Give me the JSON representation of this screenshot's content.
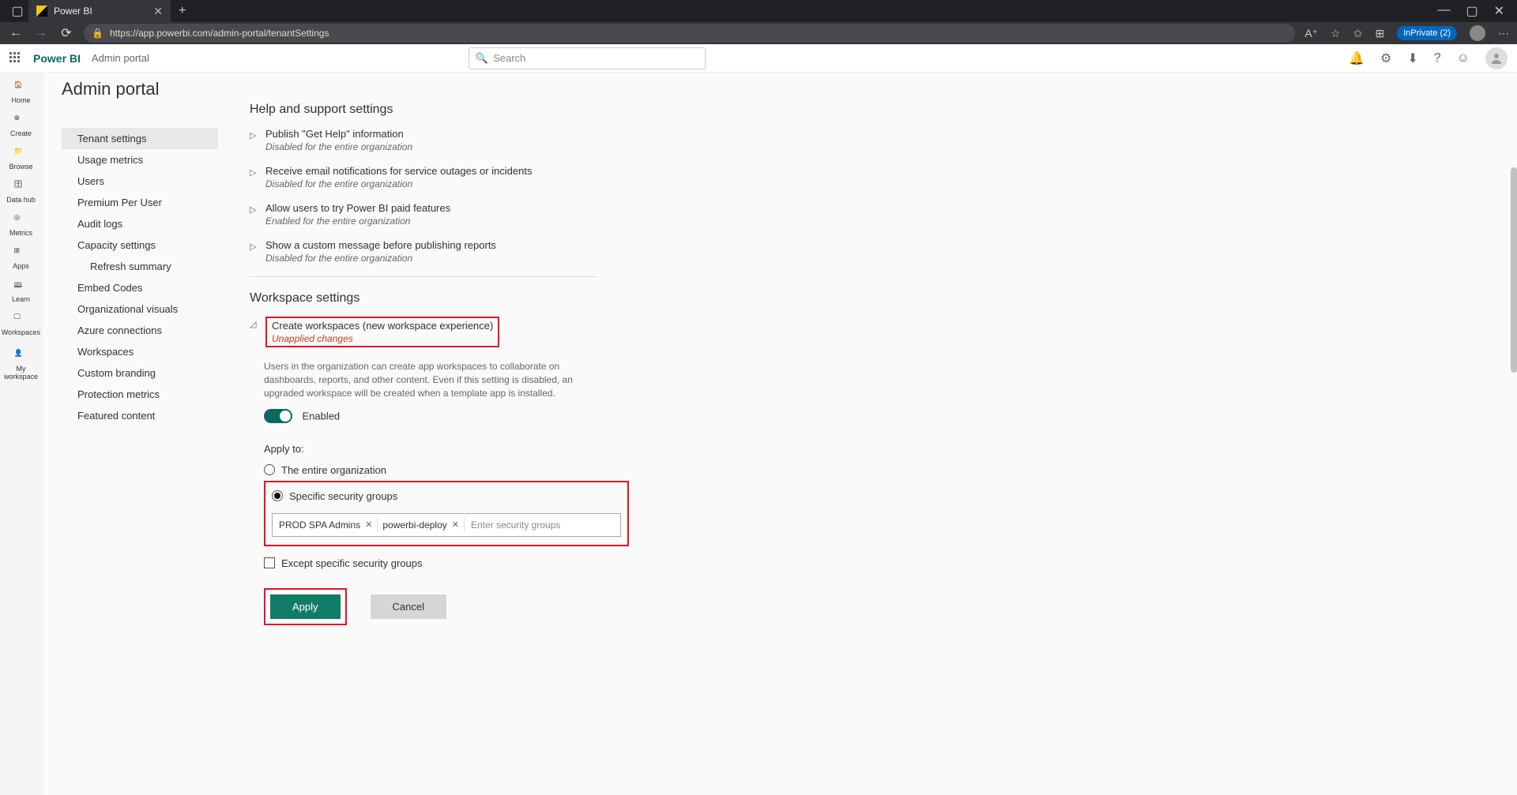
{
  "browser": {
    "tab_title": "Power BI",
    "url": "https://app.powerbi.com/admin-portal/tenantSettings",
    "inprivate_label": "InPrivate (2)"
  },
  "header": {
    "brand": "Power BI",
    "breadcrumb": "Admin portal",
    "search_placeholder": "Search"
  },
  "nav_rail": [
    {
      "label": "Home"
    },
    {
      "label": "Create"
    },
    {
      "label": "Browse"
    },
    {
      "label": "Data hub"
    },
    {
      "label": "Metrics"
    },
    {
      "label": "Apps"
    },
    {
      "label": "Learn"
    },
    {
      "label": "Workspaces"
    },
    {
      "label": "My workspace"
    }
  ],
  "page_title": "Admin portal",
  "sidebar": {
    "items": [
      {
        "label": "Tenant settings",
        "active": true
      },
      {
        "label": "Usage metrics"
      },
      {
        "label": "Users"
      },
      {
        "label": "Premium Per User"
      },
      {
        "label": "Audit logs"
      },
      {
        "label": "Capacity settings"
      },
      {
        "label": "Refresh summary",
        "sub": true
      },
      {
        "label": "Embed Codes"
      },
      {
        "label": "Organizational visuals"
      },
      {
        "label": "Azure connections"
      },
      {
        "label": "Workspaces"
      },
      {
        "label": "Custom branding"
      },
      {
        "label": "Protection metrics"
      },
      {
        "label": "Featured content"
      }
    ]
  },
  "help_section": {
    "title": "Help and support settings",
    "items": [
      {
        "label": "Publish \"Get Help\" information",
        "status": "Disabled for the entire organization"
      },
      {
        "label": "Receive email notifications for service outages or incidents",
        "status": "Disabled for the entire organization"
      },
      {
        "label": "Allow users to try Power BI paid features",
        "status": "Enabled for the entire organization"
      },
      {
        "label": "Show a custom message before publishing reports",
        "status": "Disabled for the entire organization"
      }
    ]
  },
  "workspace_section": {
    "title": "Workspace settings",
    "setting_label": "Create workspaces (new workspace experience)",
    "unapplied": "Unapplied changes",
    "description": "Users in the organization can create app workspaces to collaborate on dashboards, reports, and other content. Even if this setting is disabled, an upgraded workspace will be created when a template app is installed.",
    "toggle_label": "Enabled",
    "apply_to_label": "Apply to:",
    "radio_entire": "The entire organization",
    "radio_specific": "Specific security groups",
    "chips": [
      "PROD SPA Admins",
      "powerbi-deploy"
    ],
    "chip_placeholder": "Enter security groups",
    "except_label": "Except specific security groups",
    "apply_btn": "Apply",
    "cancel_btn": "Cancel"
  }
}
